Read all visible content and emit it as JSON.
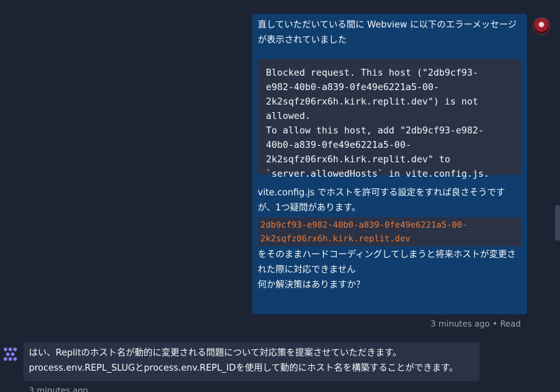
{
  "user_message": {
    "intro": "直していただいている間に Webview に以下のエラーメッセージが表示されていました",
    "error_code": "Blocked request. This host (\"2db9cf93-\ne982-40b0-a839-0fe49e6221a5-00-\n2k2sqfz06rx6h.kirk.replit.dev\") is not\nallowed.\nTo allow this host, add \"2db9cf93-e982-\n40b0-a839-0fe49e6221a5-00-\n2k2sqfz06rx6h.kirk.replit.dev\" to\n`server.allowedHosts` in vite.config.js.",
    "question": "vite.config.js でホストを許可する設定をすれば良さそうですが、1つ疑問があります。",
    "host_code": "2db9cf93-e982-40b0-a839-0fe49e6221a5-00-\n2k2sqfz06rx6h.kirk.replit.dev",
    "follow_up": "をそのままハードコーディングしてしまうと将来ホストが変更された際に対応できません",
    "ask": "何か解決策はありますか？",
    "timestamp": "3 minutes ago",
    "separator": "•",
    "read_status": "Read"
  },
  "agent_message": {
    "line1": "はい、Replitのホスト名が動的に変更される問題について対応策を提案させていただきます。",
    "line2": "process.env.REPL_SLUGとprocess.env.REPL_IDを使用して動的にホスト名を構築することができます。",
    "timestamp": "3 minutes ago"
  },
  "icons": {
    "user_avatar": "user-avatar",
    "agent_icon": "replit-agent-icon"
  },
  "colors": {
    "background": "#1c2333",
    "user_bubble": "#0f3e6e",
    "code_bg": "#2b3245",
    "inline_code_text": "#e67b3a",
    "agent_icon": "#8b7cf6"
  }
}
